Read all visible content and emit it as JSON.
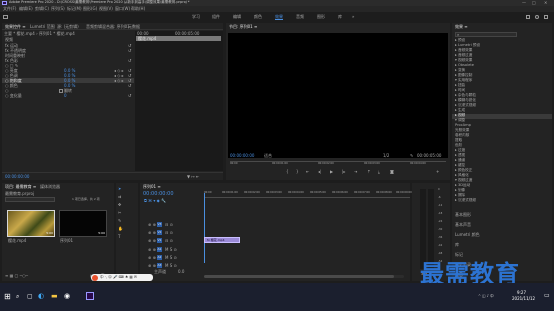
{
  "titlebar": {
    "app_title": "Adobe Premiere Pro 2020 - D:\\CROSS\\最需教育\\Premiere Pro 2020 从新手到高手\\调整效果\\最需教育.prproj *",
    "controls": [
      "—",
      "□",
      "✕"
    ]
  },
  "menubar": {
    "items": [
      "文件(F)",
      "编辑(E)",
      "剪辑(C)",
      "序列(S)",
      "标记(M)",
      "图形(G)",
      "视图(V)",
      "窗口(W)",
      "帮助(H)"
    ]
  },
  "workspaces": {
    "items": [
      "学习",
      "组件",
      "编辑",
      "颜色",
      "效果",
      "音频",
      "图形",
      "库",
      "»"
    ],
    "active": "效果"
  },
  "effect_controls": {
    "tabs": [
      "效果控件 ≡",
      "Lumetri 范围",
      "源: (无剪辑)",
      "音频剪辑混合器: 序列01",
      "元数据"
    ],
    "clip_path": "主要 * 樱花.mp4  ›  序列01 * 樱花.mp4",
    "timecode_start": "00:00",
    "timecode_end": "00:00:05:00",
    "mini_clip_label": "樱花.mp4",
    "section_video": "视频",
    "rows": [
      {
        "label": "fx  运动",
        "value": ""
      },
      {
        "label": "fx  不透明度",
        "value": ""
      },
      {
        "label": "   时间重映射",
        "value": ""
      },
      {
        "label": "fx  色彩",
        "value": ""
      },
      {
        "label": "     ○ □ ✎",
        "value": ""
      },
      {
        "label": "  ○ 亮度",
        "value": "0.0 %"
      },
      {
        "label": "  ○ 色调",
        "value": "0.0 %"
      },
      {
        "label": "  ○ 饱和度",
        "value": "0.0 %"
      },
      {
        "label": "  ○ 颜色",
        "value": "0.0 %"
      },
      {
        "label": "  ○",
        "value": "翻转"
      },
      {
        "label": "  ○ 变化量",
        "value": "0"
      }
    ],
    "bottom_timecode": "00:00:00:00"
  },
  "program_monitor": {
    "title": "节目: 序列01 ≡",
    "timecode_left": "00:00:00:00",
    "fit_label": "适合",
    "fraction": "1/2",
    "timecode_right": "00:00:05:00",
    "ruler_marks": [
      "00:00",
      "00:00:01:00",
      "00:00:02:00",
      "00:00:03:00",
      "00:00:04:00"
    ]
  },
  "project_panel": {
    "tabs": [
      "项目: 最需教育 ≡",
      "媒体浏览器"
    ],
    "file_name": "最需教育.prproj",
    "count_label": "1 项已选择，共 2 项",
    "items": [
      {
        "name": "樱花.mp4",
        "duration": "5:00"
      },
      {
        "name": "序列01",
        "duration": "5:00"
      }
    ]
  },
  "timeline": {
    "title": "序列01 ≡",
    "timecode": "00:00:00:00",
    "ruler_marks": [
      "00:00",
      "00:00:01:00",
      "00:00:02:00",
      "00:00:03:00",
      "00:00:04:00",
      "00:00:05:00",
      "00:00:06:00",
      "00:00:07:00",
      "00:00:08:00",
      "00:00:09:00"
    ],
    "tracks": [
      "V3",
      "V2",
      "V1",
      "A1",
      "A2",
      "A3"
    ],
    "master_label": "主声道",
    "master_value": "0.0",
    "clip_label": "fx 樱花.mp4"
  },
  "effects_panel": {
    "title": "效果 ≡",
    "search_placeholder": "",
    "items": [
      "▸ 预设",
      "▸ Lumetri 预设",
      "▸ 音频效果",
      "▸ 音频过渡",
      "▾ 视频效果",
      "   ▸ Obsolete",
      "   ▸ 变换",
      "   ▸ 图像控制",
      "   ▾ 实用程序",
      "   ▸ 扭曲",
      "   ▸ 时间",
      "   ▸ 杂色与颗粒",
      "   ▸ 模糊与锐化",
      "   ▸ 沉浸式视频",
      "   ▸ 生成",
      "   ▸ 视频",
      "   ▾ 调整",
      "        ProcAmp",
      "        光照效果",
      "        卷积内核",
      "        提取",
      "        色阶",
      "   ▸ 过渡",
      "   ▸ 透视",
      "   ▸ 通道",
      "   ▸ 键控",
      "   ▸ 颜色校正",
      "   ▸ 风格化",
      "▾ 视频过渡",
      "   ▸ 3D运动",
      "   ▸ 划像",
      "   ▸ 擦除",
      "   ▸ 沉浸式视频"
    ],
    "selected_index": 15,
    "bottom_links": [
      "基本图形",
      "基本声音",
      "Lumetri 颜色",
      "库",
      "标记",
      "历史记录",
      "信息"
    ]
  },
  "audio_meter": {
    "labels": [
      "0",
      "-6",
      "-12",
      "-18",
      "-24",
      "-30",
      "-36",
      "-42",
      "-48",
      "-54"
    ],
    "bottom": "S S"
  },
  "taskbar": {
    "time": "9:27",
    "date": "2021/11/12"
  },
  "watermark": {
    "text": "最需教育"
  },
  "colors": {
    "accent": "#2d8ceb",
    "clip": "#9b8ad8",
    "panel": "#232323"
  }
}
